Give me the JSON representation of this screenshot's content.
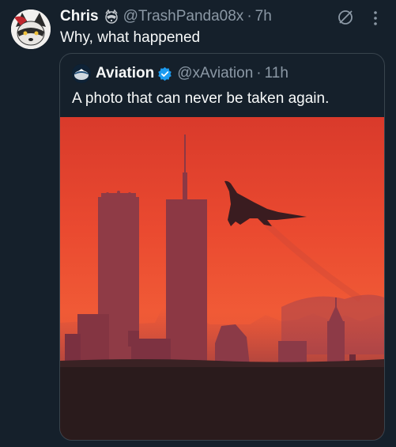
{
  "tweet": {
    "author_name": "Chris",
    "author_handle": "@TrashPanda08x",
    "separator": "·",
    "time": "7h",
    "text": "Why, what happened",
    "author_emoji": "raccoon-emoji",
    "actions": {
      "grok_icon": "grok-icon",
      "more_icon": "more-options-icon"
    }
  },
  "quoted_tweet": {
    "author_name": "Aviation",
    "author_handle": "@xAviation",
    "separator": "·",
    "time": "11h",
    "text": "A photo that can never be taken again.",
    "verified_icon": "verified-badge-icon",
    "photo_alt": "Concorde silhouette flying past the Twin Towers at sunset"
  },
  "colors": {
    "background": "#15202b",
    "text": "#f7f9f9",
    "secondary": "#8b98a5",
    "border": "#38444d",
    "verified": "#1d9bf0",
    "sky": "#e8452f"
  }
}
